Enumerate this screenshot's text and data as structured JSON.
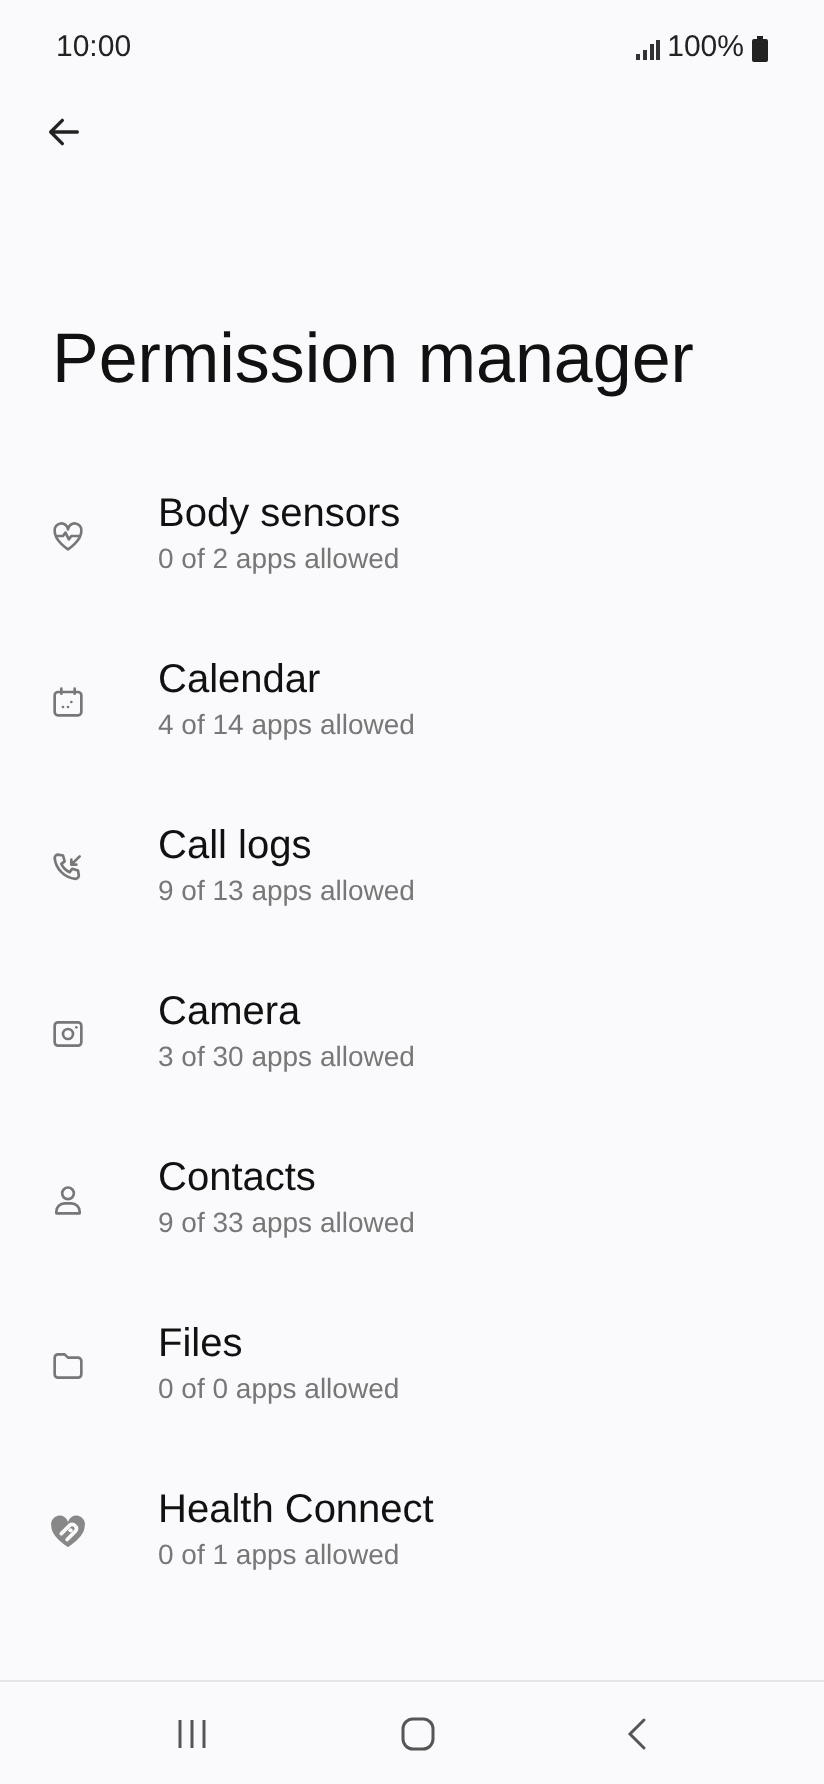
{
  "status_bar": {
    "time": "10:00",
    "battery": "100%"
  },
  "title": "Permission manager",
  "items": [
    {
      "kind": "sensors",
      "name": "Body sensors",
      "summary": "0 of 2 apps allowed"
    },
    {
      "kind": "calendar",
      "name": "Calendar",
      "summary": "4 of 14 apps allowed"
    },
    {
      "kind": "calls",
      "name": "Call logs",
      "summary": "9 of 13 apps allowed"
    },
    {
      "kind": "camera",
      "name": "Camera",
      "summary": "3 of 30 apps allowed"
    },
    {
      "kind": "contacts",
      "name": "Contacts",
      "summary": "9 of 33 apps allowed"
    },
    {
      "kind": "files",
      "name": "Files",
      "summary": "0 of 0 apps allowed"
    },
    {
      "kind": "health",
      "name": "Health Connect",
      "summary": "0 of 1 apps allowed"
    }
  ]
}
